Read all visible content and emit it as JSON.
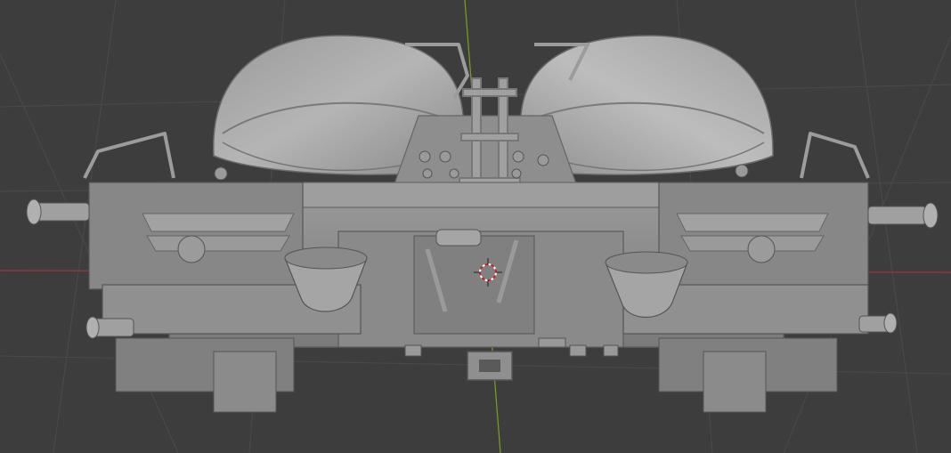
{
  "viewport": {
    "background_color": "#3d3d3d",
    "grid_color": "#4a4a4a",
    "x_axis_color": "#a3323e",
    "y_axis_color": "#7aa11d",
    "model_color": "#8c8c8c",
    "model_shadow_color": "#5f5f5f",
    "model_highlight_color": "#b3b3b3"
  },
  "scene": {
    "object": "tank-wagon-bogie-model",
    "cursor_icon": "3d-cursor-icon"
  }
}
